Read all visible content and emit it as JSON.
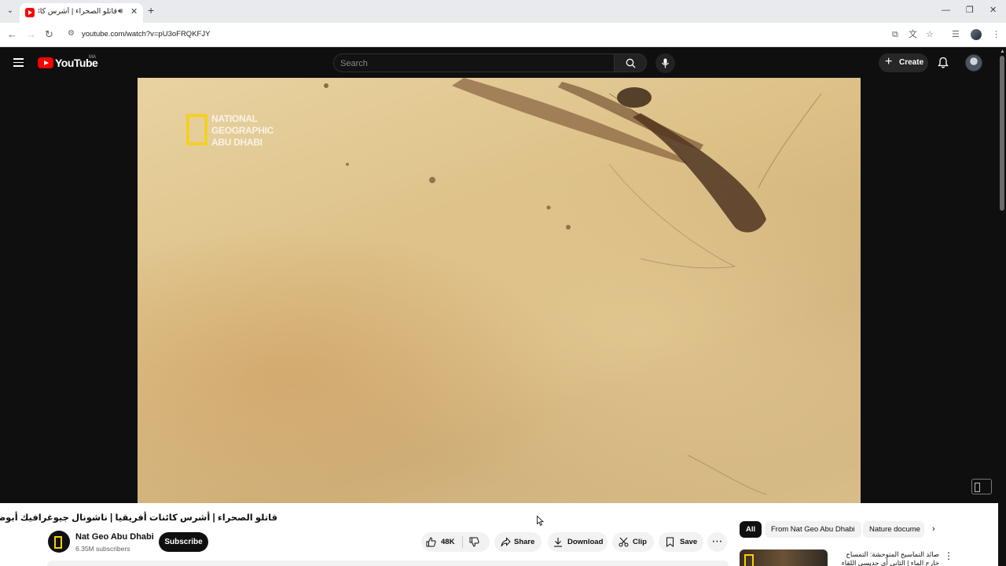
{
  "browser": {
    "tab": {
      "title": "قاتلو الصحراء | أشرس كائنات أفريقيا",
      "audio_icon": "speaker-icon",
      "close": "✕"
    },
    "new_tab": "+",
    "window_controls": {
      "minimize": "—",
      "maximize": "❐",
      "close": "✕"
    },
    "url": "youtube.com/watch?v=pU3oFRQKFJY",
    "icons": [
      "back-icon",
      "forward-icon",
      "reload-icon",
      "site-info-icon",
      "install-icon",
      "translate-icon",
      "bookmark-star-icon",
      "reading-list-icon",
      "profile-icon",
      "menu-kebab-icon"
    ]
  },
  "youtube": {
    "logo_text": "YouTube",
    "country": "MA",
    "search_placeholder": "Search",
    "create_label": "Create"
  },
  "player": {
    "logo_lines": [
      "NATIONAL",
      "GEOGRAPHIC",
      "ABU DHABI"
    ]
  },
  "video": {
    "title": "قاتلو الصحراء | أشرس كائنات أفريقيا | ناشونال جيوغرافيك أبوظبي",
    "channel_name": "Nat Geo Abu Dhabi",
    "subscribers": "6.35M subscribers",
    "subscribe_label": "Subscribe",
    "likes": "48K",
    "share_label": "Share",
    "download_label": "Download",
    "clip_label": "Clip",
    "save_label": "Save",
    "more": "⋯"
  },
  "related": {
    "chips": [
      "All",
      "From Nat Geo Abu Dhabi",
      "Nature docume"
    ],
    "first_item_title": "صائد التماسيح المتوحشة: التمساح خارج الماء | الثاني أي حديسي اللقاء أبوظ"
  },
  "colors": {
    "youtube_red": "#ff0000",
    "ng_yellow": "#f6d200",
    "dark_bg": "#0f0f0f"
  }
}
